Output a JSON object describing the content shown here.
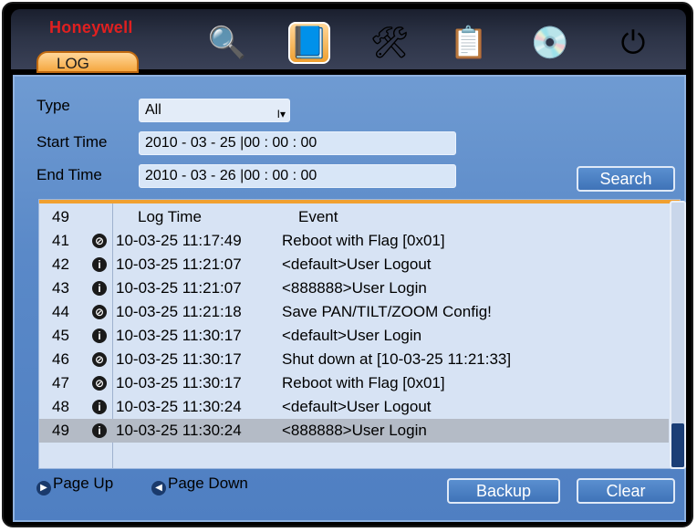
{
  "brand": "Honeywell",
  "tab": {
    "label": "LOG"
  },
  "toolbar_icons": [
    {
      "name": "search-people-icon",
      "glyph": "🔍"
    },
    {
      "name": "info-book-icon",
      "glyph": "📘",
      "active": true
    },
    {
      "name": "tools-icon",
      "glyph": "🛠"
    },
    {
      "name": "settings-list-icon",
      "glyph": "📋"
    },
    {
      "name": "backup-disk-icon",
      "glyph": "💿"
    },
    {
      "name": "power-hdd-icon",
      "glyph": "⏻"
    }
  ],
  "filters": {
    "type_label": "Type",
    "type_value": "All",
    "start_label": "Start Time",
    "start_value": "2010  - 03 - 25  |00 :  00 :  00",
    "end_label": "End Time",
    "end_value": "2010  - 03 - 26  |00 :  00 :  00",
    "search_label": "Search"
  },
  "table": {
    "count": "49",
    "col_time": "Log Time",
    "col_event": "Event",
    "rows": [
      {
        "no": "41",
        "icon": "event",
        "time": "10-03-25 11:17:49",
        "event": "Reboot with Flag [0x01]"
      },
      {
        "no": "42",
        "icon": "info",
        "time": "10-03-25 11:21:07",
        "event": "<default>User Logout"
      },
      {
        "no": "43",
        "icon": "info",
        "time": "10-03-25 11:21:07",
        "event": "<888888>User Login"
      },
      {
        "no": "44",
        "icon": "event",
        "time": "10-03-25 11:21:18",
        "event": "Save PAN/TILT/ZOOM Config!"
      },
      {
        "no": "45",
        "icon": "info",
        "time": "10-03-25 11:30:17",
        "event": "<default>User Login"
      },
      {
        "no": "46",
        "icon": "event",
        "time": "10-03-25 11:30:17",
        "event": "Shut down at [10-03-25 11:21:33]"
      },
      {
        "no": "47",
        "icon": "event",
        "time": "10-03-25 11:30:17",
        "event": "Reboot with Flag [0x01]"
      },
      {
        "no": "48",
        "icon": "info",
        "time": "10-03-25 11:30:24",
        "event": "<default>User Logout"
      },
      {
        "no": "49",
        "icon": "info",
        "time": "10-03-25 11:30:24",
        "event": "<888888>User Login",
        "selected": true
      }
    ]
  },
  "footer": {
    "page_up": "Page Up",
    "page_down": "Page Down",
    "backup": "Backup",
    "clear": "Clear"
  }
}
